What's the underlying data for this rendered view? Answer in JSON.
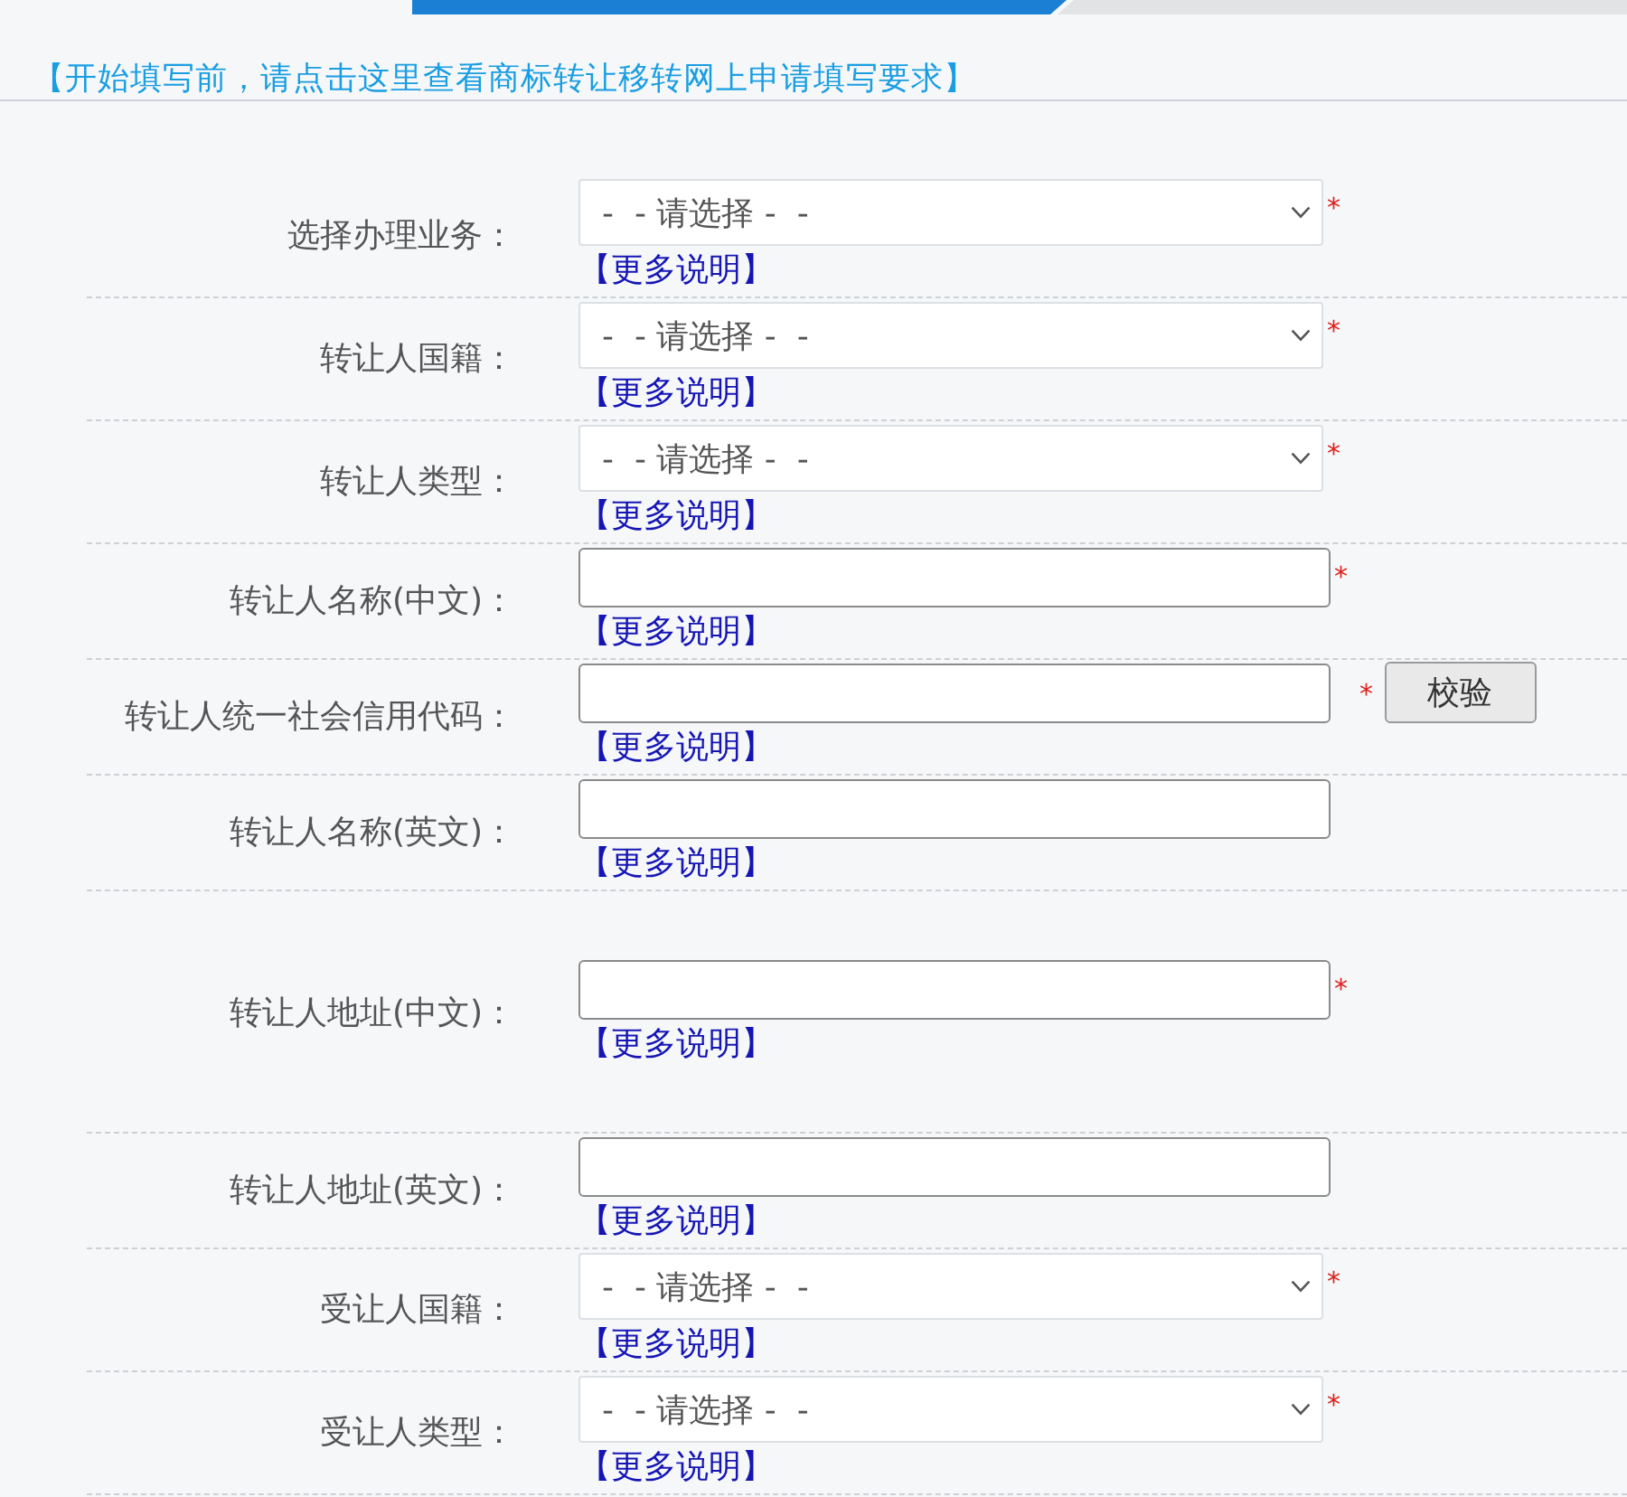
{
  "tab_strip": [
    {
      "selected": true
    },
    {
      "selected": false
    }
  ],
  "notice_link": "【开始填写前，请点击这里查看商标转让移转网上申请填写要求】",
  "form": {
    "rows": [
      {
        "label": "选择办理业务：",
        "field": {
          "kind": "select",
          "value": "-  - 请选择 -  -"
        },
        "required_mark": "*",
        "help_link": "【更多说明】"
      },
      {
        "label": "转让人国籍：",
        "field": {
          "kind": "select",
          "value": "-  - 请选择 -  -"
        },
        "required_mark": "*",
        "help_link": "【更多说明】"
      },
      {
        "label": "转让人类型：",
        "field": {
          "kind": "select",
          "value": "-  - 请选择 -  -"
        },
        "required_mark": "*",
        "help_link": "【更多说明】"
      },
      {
        "label": "转让人名称(中文)：",
        "field": {
          "kind": "text"
        },
        "required_mark": "*",
        "help_link": "【更多说明】"
      },
      {
        "label": "转让人统一社会信用代码：",
        "field": {
          "kind": "text"
        },
        "required_mark": "*",
        "button": "校验",
        "help_link": "【更多说明】"
      },
      {
        "label": "转让人名称(英文)：",
        "field": {
          "kind": "text"
        },
        "help_link": "【更多说明】"
      },
      {
        "label": "转让人地址(中文)：",
        "field": {
          "kind": "text"
        },
        "required_mark": "*",
        "help_link": "【更多说明】"
      },
      {
        "label": "转让人地址(英文)：",
        "field": {
          "kind": "text"
        },
        "help_link": "【更多说明】"
      },
      {
        "label": "受让人国籍：",
        "field": {
          "kind": "select",
          "value": "-  - 请选择 -  -"
        },
        "required_mark": "*",
        "help_link": "【更多说明】"
      },
      {
        "label": "受让人类型：",
        "field": {
          "kind": "select",
          "value": "-  - 请选择 -  -"
        },
        "required_mark": "*",
        "help_link": "【更多说明】"
      }
    ]
  }
}
